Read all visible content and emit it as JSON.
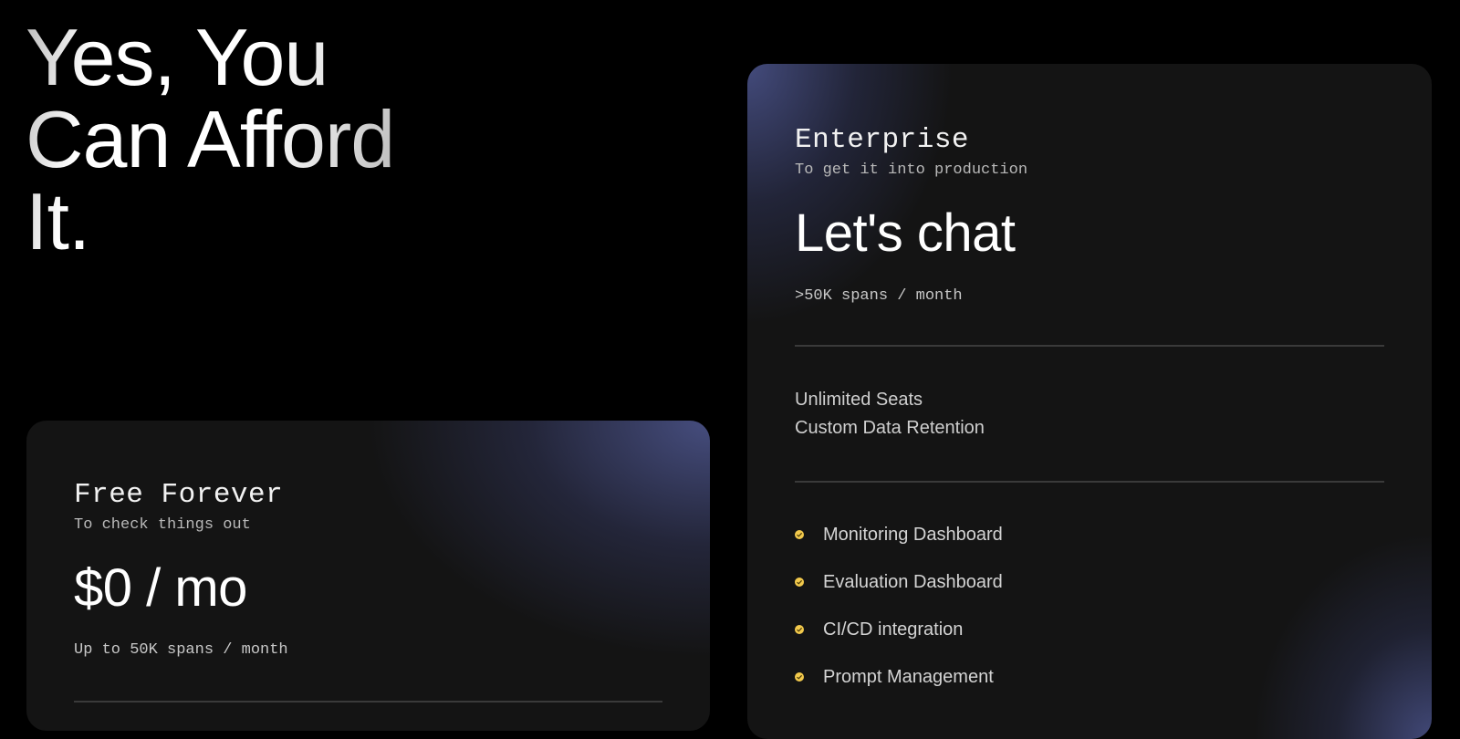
{
  "hero": {
    "line1": "Yes, You",
    "line2": "Can Afford",
    "line3": "It."
  },
  "plans": {
    "free": {
      "name": "Free Forever",
      "subtitle": "To check things out",
      "price": "$0 / mo",
      "spans": "Up to 50K spans / month"
    },
    "enterprise": {
      "name": "Enterprise",
      "subtitle": "To get it into production",
      "price": "Let's chat",
      "spans": ">50K spans / month",
      "seats": [
        "Unlimited Seats",
        "Custom Data Retention"
      ],
      "features": [
        "Monitoring Dashboard",
        "Evaluation Dashboard",
        "CI/CD integration",
        "Prompt Management"
      ]
    }
  },
  "icons": {
    "feature_bullet": "check-circle-icon"
  },
  "colors": {
    "background": "#000000",
    "card": "#141414",
    "accent_gradient": "#4a5287",
    "check": "#f2c94c",
    "divider": "#3a3a3a"
  }
}
